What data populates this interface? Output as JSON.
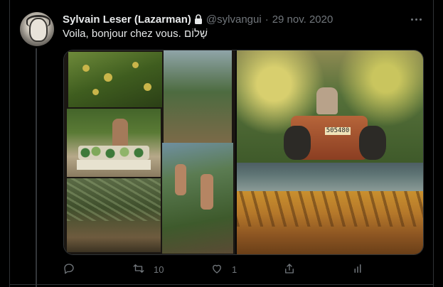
{
  "tweet": {
    "display_name": "Sylvain Leser (Lazarman)",
    "handle": "@sylvangui",
    "separator": "·",
    "date": "29 nov. 2020",
    "text": "Voila, bonjour chez vous. שָׁלוֹם"
  },
  "media": {
    "tractor_plate": "505480"
  },
  "actions": {
    "reply_count": "",
    "retweet_count": "10",
    "like_count": "1",
    "share_count": "",
    "analytics_count": ""
  },
  "icons": {
    "avatar": "avatar",
    "lock": "lock-icon",
    "more": "more-options-icon",
    "reply": "reply-icon",
    "retweet": "retweet-icon",
    "like": "heart-icon",
    "share": "share-icon",
    "analytics": "analytics-icon"
  },
  "colors": {
    "background": "#000000",
    "text_primary": "#e7e9ea",
    "text_secondary": "#71767b",
    "border": "#2f3336"
  }
}
